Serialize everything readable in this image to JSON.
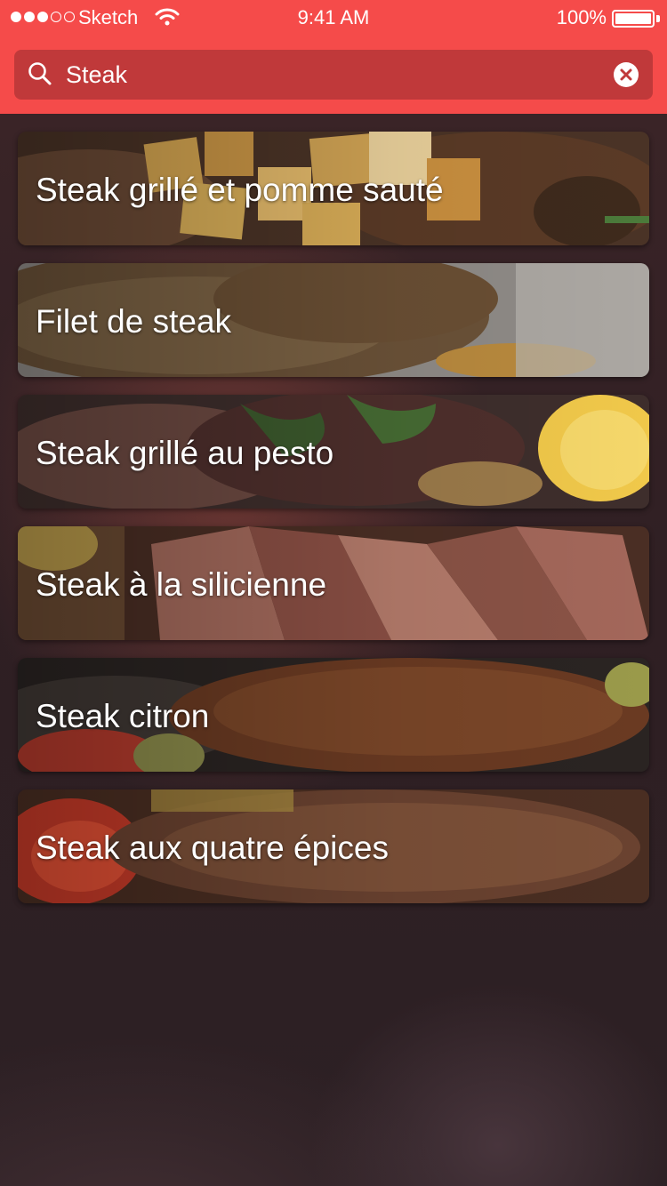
{
  "status_bar": {
    "carrier": "Sketch",
    "time": "9:41 AM",
    "battery": "100%"
  },
  "search": {
    "value": "Steak",
    "placeholder": "",
    "icon": "search-icon",
    "clear_icon": "clear-icon"
  },
  "colors": {
    "accent": "#f54b4a",
    "search_field": "#c0393a",
    "background": "#2e1f22"
  },
  "results": [
    {
      "label": "Steak grillé et pomme sauté"
    },
    {
      "label": "Filet de steak"
    },
    {
      "label": "Steak grillé au pesto"
    },
    {
      "label": "Steak à la silicienne"
    },
    {
      "label": "Steak citron"
    },
    {
      "label": "Steak aux quatre épices"
    }
  ]
}
